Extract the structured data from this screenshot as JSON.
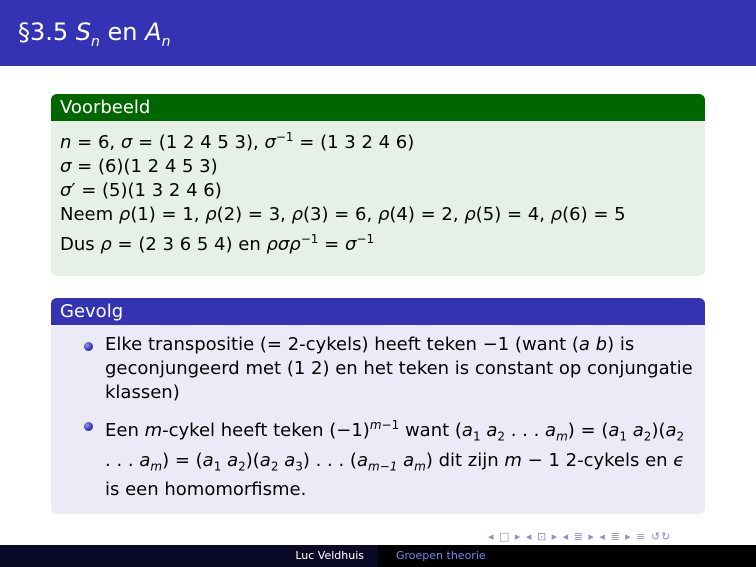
{
  "header": {
    "title": "§3.5 Sn en An"
  },
  "example_block": {
    "title": "Voorbeeld",
    "lines": [
      "n = 6, σ = (1 2 4 5 3), σ−1 = (1 3 2 4 6)",
      "σ = (6)(1 2 4 5 3)",
      "σ′ = (5)(1 3 2 4 6)",
      "Neem ρ(1) = 1, ρ(2) = 3, ρ(3) = 6, ρ(4) = 2, ρ(5) = 4, ρ(6) = 5",
      "Dus ρ = (2 3 6 5 4) en ρσρ−1 = σ−1"
    ]
  },
  "corollary_block": {
    "title": "Gevolg",
    "items": [
      "Elke transpositie (= 2-cykels) heeft teken −1 (want (a b) is geconjungeerd met (1 2) en het teken is constant op conjungatie klassen)",
      "Een m-cykel heeft teken (−1)m−1 want (a1 a2 . . . am) = (a1 a2)(a2 . . . am) = (a1 a2)(a2 a3) . . . (am−1 am) dit zijn m − 1 2-cykels en ϵ is een homomorfisme."
    ]
  },
  "navigation": {
    "symbols": "◂ □ ▸ ◂ ⊡ ▸ ◂ ≣ ▸ ◂ ≣ ▸  ≡  ↺↻"
  },
  "footer": {
    "author": "Luc Veldhuis",
    "course": "Groepen theorie"
  }
}
